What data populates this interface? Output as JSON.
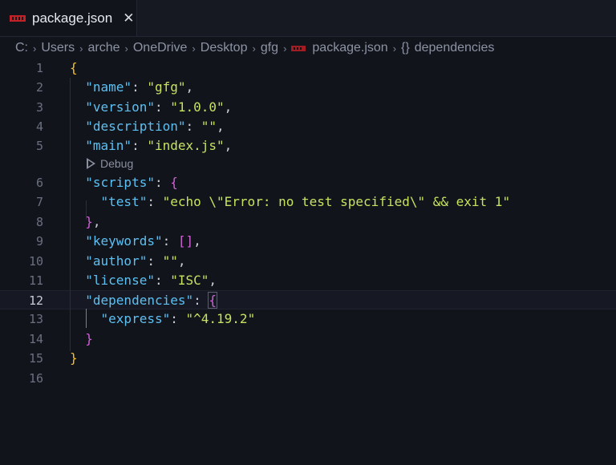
{
  "tab": {
    "label": "package.json",
    "close_glyph": "✕",
    "icon": "npm-icon"
  },
  "breadcrumb": {
    "items": [
      "C:",
      "Users",
      "arche",
      "OneDrive",
      "Desktop",
      "gfg"
    ],
    "file": "package.json",
    "symbol_glyph": "{}",
    "symbol": "dependencies",
    "separator": "›"
  },
  "codelens": {
    "label": "Debug",
    "icon": "play-icon"
  },
  "editor": {
    "current_line": 12,
    "lines": [
      {
        "n": "1",
        "tokens": [
          {
            "t": "{",
            "c": "b1"
          }
        ]
      },
      {
        "n": "2",
        "tokens": [
          {
            "t": "  "
          },
          {
            "t": "\"name\"",
            "c": "k"
          },
          {
            "t": ": ",
            "c": "p"
          },
          {
            "t": "\"gfg\"",
            "c": "s"
          },
          {
            "t": ",",
            "c": "p"
          }
        ]
      },
      {
        "n": "3",
        "tokens": [
          {
            "t": "  "
          },
          {
            "t": "\"version\"",
            "c": "k"
          },
          {
            "t": ": ",
            "c": "p"
          },
          {
            "t": "\"1.0.0\"",
            "c": "s"
          },
          {
            "t": ",",
            "c": "p"
          }
        ]
      },
      {
        "n": "4",
        "tokens": [
          {
            "t": "  "
          },
          {
            "t": "\"description\"",
            "c": "k"
          },
          {
            "t": ": ",
            "c": "p"
          },
          {
            "t": "\"\"",
            "c": "s"
          },
          {
            "t": ",",
            "c": "p"
          }
        ]
      },
      {
        "n": "5",
        "tokens": [
          {
            "t": "  "
          },
          {
            "t": "\"main\"",
            "c": "k"
          },
          {
            "t": ": ",
            "c": "p"
          },
          {
            "t": "\"index.js\"",
            "c": "s"
          },
          {
            "t": ",",
            "c": "p"
          }
        ]
      },
      {
        "n": "6",
        "tokens": [
          {
            "t": "  "
          },
          {
            "t": "\"scripts\"",
            "c": "k"
          },
          {
            "t": ": ",
            "c": "p"
          },
          {
            "t": "{",
            "c": "b2"
          }
        ]
      },
      {
        "n": "7",
        "tokens": [
          {
            "t": "    "
          },
          {
            "t": "\"test\"",
            "c": "k"
          },
          {
            "t": ": ",
            "c": "p"
          },
          {
            "t": "\"echo \\\"Error: no test specified\\\" && exit 1\"",
            "c": "s"
          }
        ]
      },
      {
        "n": "8",
        "tokens": [
          {
            "t": "  "
          },
          {
            "t": "}",
            "c": "b2"
          },
          {
            "t": ",",
            "c": "p"
          }
        ]
      },
      {
        "n": "9",
        "tokens": [
          {
            "t": "  "
          },
          {
            "t": "\"keywords\"",
            "c": "k"
          },
          {
            "t": ": ",
            "c": "p"
          },
          {
            "t": "[]",
            "c": "b2"
          },
          {
            "t": ",",
            "c": "p"
          }
        ]
      },
      {
        "n": "10",
        "tokens": [
          {
            "t": "  "
          },
          {
            "t": "\"author\"",
            "c": "k"
          },
          {
            "t": ": ",
            "c": "p"
          },
          {
            "t": "\"\"",
            "c": "s"
          },
          {
            "t": ",",
            "c": "p"
          }
        ]
      },
      {
        "n": "11",
        "tokens": [
          {
            "t": "  "
          },
          {
            "t": "\"license\"",
            "c": "k"
          },
          {
            "t": ": ",
            "c": "p"
          },
          {
            "t": "\"ISC\"",
            "c": "s"
          },
          {
            "t": ",",
            "c": "p"
          }
        ]
      },
      {
        "n": "12",
        "tokens": [
          {
            "t": "  "
          },
          {
            "t": "\"dependencies\"",
            "c": "k"
          },
          {
            "t": ": ",
            "c": "p"
          },
          {
            "t": "{",
            "c": "b2",
            "match": true
          }
        ]
      },
      {
        "n": "13",
        "tokens": [
          {
            "t": "    "
          },
          {
            "t": "\"express\"",
            "c": "k"
          },
          {
            "t": ": ",
            "c": "p"
          },
          {
            "t": "\"^4.19.2\"",
            "c": "s"
          }
        ]
      },
      {
        "n": "14",
        "tokens": [
          {
            "t": "  "
          },
          {
            "t": "}",
            "c": "b2"
          }
        ]
      },
      {
        "n": "15",
        "tokens": [
          {
            "t": "}",
            "c": "b1"
          }
        ]
      },
      {
        "n": "16",
        "tokens": []
      }
    ]
  }
}
